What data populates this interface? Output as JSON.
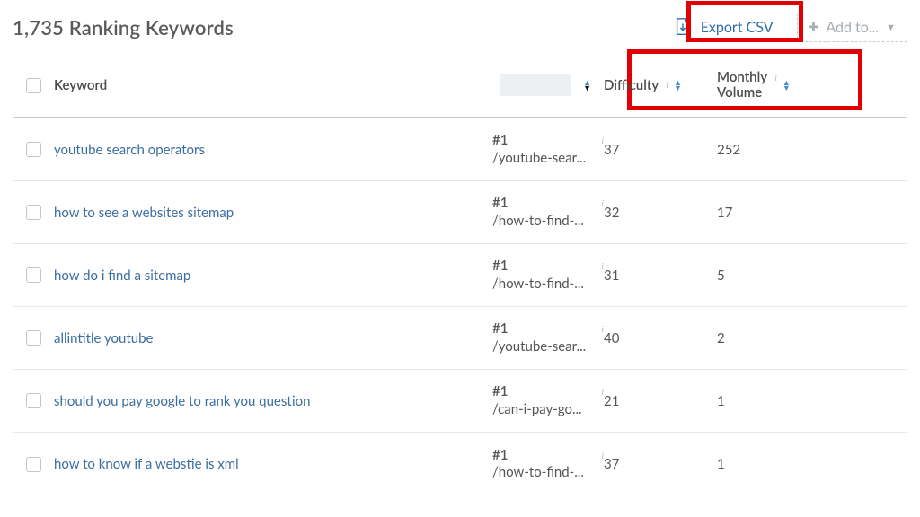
{
  "title": "1,735 Ranking Keywords",
  "actions": {
    "export_label": "Export CSV",
    "addto_label": "Add to..."
  },
  "columns": {
    "keyword": "Keyword",
    "difficulty": "Difficulty",
    "volume_line1": "Monthly",
    "volume_line2": "Volume"
  },
  "rows": [
    {
      "keyword": "youtube search operators",
      "rank": "#1",
      "url": "/youtube-sear...",
      "difficulty": "37",
      "volume": "252"
    },
    {
      "keyword": "how to see a websites sitemap",
      "rank": "#1",
      "url": "/how-to-find-...",
      "difficulty": "32",
      "volume": "17"
    },
    {
      "keyword": "how do i find a sitemap",
      "rank": "#1",
      "url": "/how-to-find-...",
      "difficulty": "31",
      "volume": "5"
    },
    {
      "keyword": "allintitle youtube",
      "rank": "#1",
      "url": "/youtube-sear...",
      "difficulty": "40",
      "volume": "2"
    },
    {
      "keyword": "should you pay google to rank you question",
      "rank": "#1",
      "url": "/can-i-pay-go...",
      "difficulty": "21",
      "volume": "1"
    },
    {
      "keyword": "how to know if a webstie is xml",
      "rank": "#1",
      "url": "/how-to-find-...",
      "difficulty": "37",
      "volume": "1"
    }
  ]
}
